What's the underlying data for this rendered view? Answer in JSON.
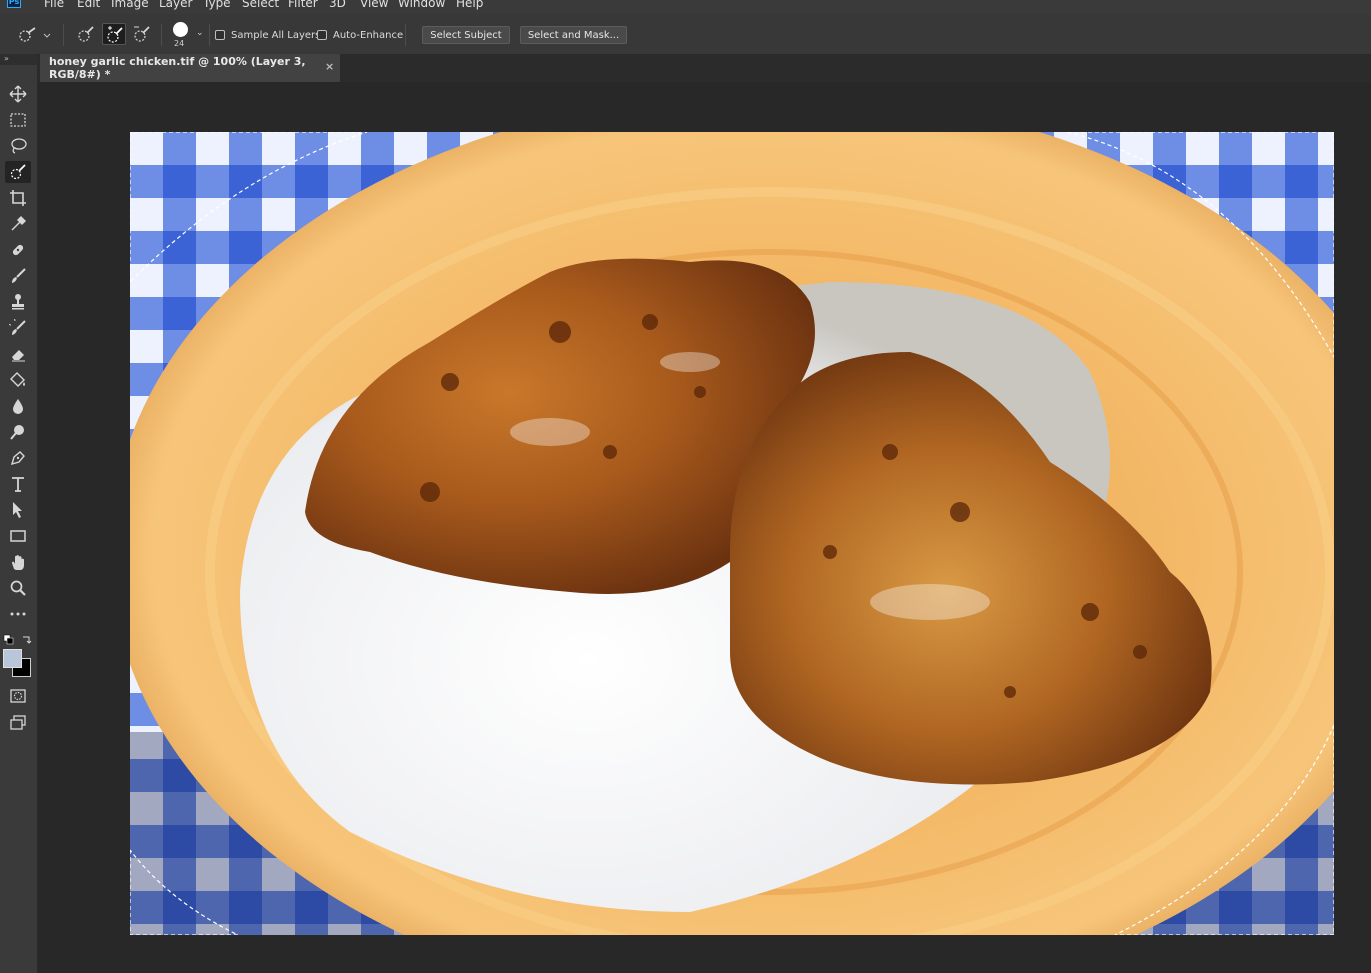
{
  "app": {
    "logo_text": "Ps"
  },
  "menu": [
    "File",
    "Edit",
    "Image",
    "Layer",
    "Type",
    "Select",
    "Filter",
    "3D",
    "View",
    "Window",
    "Help"
  ],
  "options": {
    "brush_size": "24",
    "sample_all_layers": "Sample All Layers",
    "auto_enhance": "Auto-Enhance",
    "select_subject": "Select Subject",
    "select_and_mask": "Select and Mask..."
  },
  "document": {
    "tab_title": "honey garlic chicken.tif @ 100% (Layer 3, RGB/8#) *",
    "close_glyph": "×"
  },
  "colors": {
    "accent": "#31a8ff",
    "foreground": "#b9c6d9",
    "background": "#000000",
    "tablecloth": "#3c63d6",
    "plate": "#f2b35a"
  },
  "tools": [
    "move",
    "rectangular-marquee",
    "lasso",
    "quick-selection",
    "crop",
    "eyedropper",
    "healing-brush",
    "brush",
    "clone-stamp",
    "history-brush",
    "eraser",
    "paint-bucket",
    "blur",
    "dodge",
    "pen",
    "type",
    "path-selection",
    "rectangle",
    "hand",
    "zoom",
    "more-tools"
  ]
}
